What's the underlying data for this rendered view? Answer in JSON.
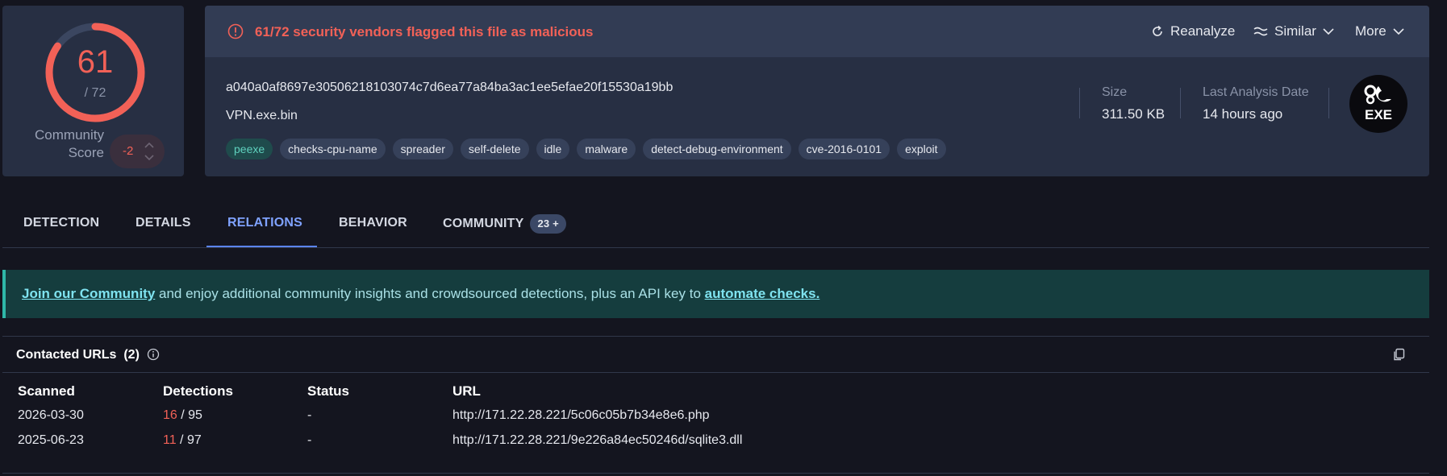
{
  "score": {
    "detections": "61",
    "total": "/ 72",
    "detection_fraction": 0.847,
    "community_label_line1": "Community",
    "community_label_line2": "Score",
    "community_value": "-2"
  },
  "alert": {
    "text": "61/72 security vendors flagged this file as malicious",
    "reanalyze_label": "Reanalyze",
    "similar_label": "Similar",
    "more_label": "More"
  },
  "file": {
    "hash": "a040a0af8697e30506218103074c7d6ea77a84ba3ac1ee5efae20f15530a19bb",
    "name": "VPN.exe.bin",
    "tags": [
      "peexe",
      "checks-cpu-name",
      "spreader",
      "self-delete",
      "idle",
      "malware",
      "detect-debug-environment",
      "cve-2016-0101",
      "exploit"
    ],
    "size_label": "Size",
    "size_value": "311.50 KB",
    "date_label": "Last Analysis Date",
    "date_value": "14 hours ago",
    "type_icon_label": "EXE"
  },
  "tabs": [
    {
      "label": "DETECTION"
    },
    {
      "label": "DETAILS"
    },
    {
      "label": "RELATIONS",
      "active": true
    },
    {
      "label": "BEHAVIOR"
    },
    {
      "label": "COMMUNITY",
      "badge": "23 +"
    }
  ],
  "banner": {
    "link1": "Join our Community",
    "middle": " and enjoy additional community insights and crowdsourced detections, plus an API key to ",
    "link2": "automate checks."
  },
  "contacted_urls": {
    "title": "Contacted URLs",
    "count": "(2)",
    "columns": [
      "Scanned",
      "Detections",
      "Status",
      "URL"
    ],
    "rows": [
      {
        "scanned": "2026-03-30",
        "det": "16",
        "det_total": " / 95",
        "status": "-",
        "url": "http://171.22.28.221/5c06c05b7b34e8e6.php"
      },
      {
        "scanned": "2025-06-23",
        "det": "11",
        "det_total": " / 97",
        "status": "-",
        "url": "http://171.22.28.221/9e226a84ec50246d/sqlite3.dll"
      }
    ]
  },
  "colors": {
    "malicious": "#f26157",
    "accent": "#5b84f2",
    "banner_bg": "#153d3e"
  }
}
